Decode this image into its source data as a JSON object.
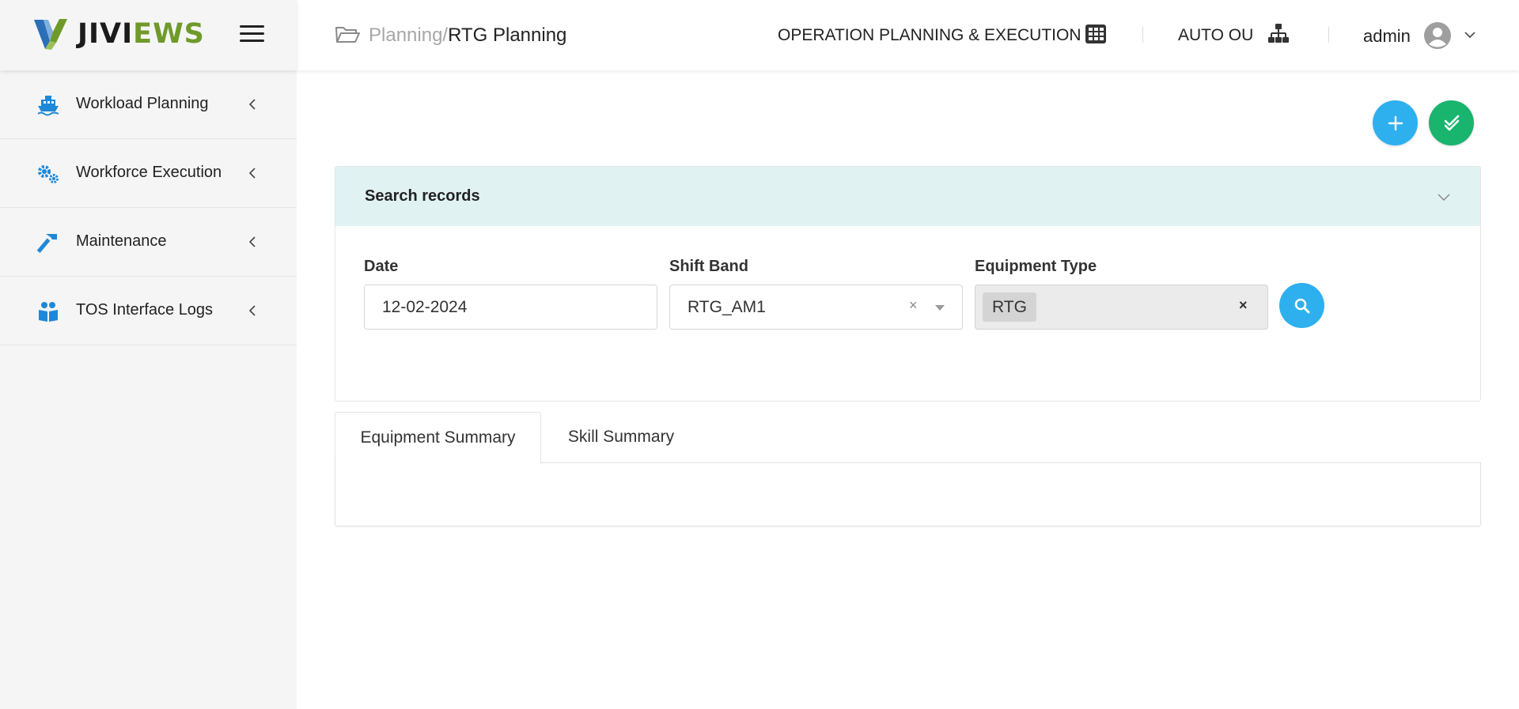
{
  "app": {
    "logo_part1": "JIVI",
    "logo_part2": "EWS"
  },
  "sidebar": {
    "items": [
      {
        "label": "Workload Planning",
        "icon": "ship-icon"
      },
      {
        "label": "Workforce Execution",
        "icon": "gears-icon"
      },
      {
        "label": "Maintenance",
        "icon": "hammer-icon"
      },
      {
        "label": "TOS Interface Logs",
        "icon": "users-book-icon"
      }
    ]
  },
  "header": {
    "breadcrumb_parent": "Planning/",
    "breadcrumb_current": "RTG Planning",
    "module": "OPERATION PLANNING & EXECUTION",
    "org_unit": "AUTO OU",
    "user": "admin"
  },
  "search": {
    "title": "Search records",
    "date_label": "Date",
    "date_value": "12-02-2024",
    "shift_label": "Shift Band",
    "shift_value": "RTG_AM1",
    "equipment_label": "Equipment Type",
    "equipment_tag": "RTG"
  },
  "tabs": [
    {
      "label": "Equipment Summary",
      "active": true
    },
    {
      "label": "Skill Summary",
      "active": false
    }
  ],
  "colors": {
    "accent_blue": "#2eb0ef",
    "accent_green": "#19b46e",
    "panel_header": "#e1f2f3",
    "logo_green": "#6f9a2a",
    "icon_blue": "#1e88d8"
  }
}
